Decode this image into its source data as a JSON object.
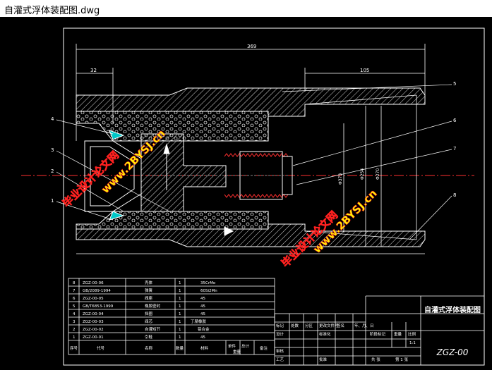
{
  "window": {
    "title": "自灌式浮体装配图.dwg"
  },
  "dims": {
    "overall": "369",
    "left": "32",
    "right": "105",
    "d1": "Φ373",
    "d2": "Φ254",
    "d3": "Φ270"
  },
  "leaders": [
    "5",
    "6",
    "7",
    "8",
    "4",
    "3",
    "2",
    "1"
  ],
  "watermarks": [
    "毕业设计论文网",
    "www.2BYSJ.cn"
  ],
  "bom": {
    "rows": [
      {
        "no": "8",
        "code": "ZGZ-00-06",
        "name": "壳体",
        "qty": "1",
        "mat": "35CrMo"
      },
      {
        "no": "7",
        "code": "GB/2089-1994",
        "name": "弹簧",
        "qty": "1",
        "mat": "60Si2Mn"
      },
      {
        "no": "6",
        "code": "ZGZ-00-05",
        "name": "阀座",
        "qty": "1",
        "mat": "45"
      },
      {
        "no": "5",
        "code": "GB/T6853-1999",
        "name": "橡胶密封",
        "qty": "1",
        "mat": "45"
      },
      {
        "no": "4",
        "code": "ZGZ-00-04",
        "name": "挡圈",
        "qty": "1",
        "mat": "45"
      },
      {
        "no": "3",
        "code": "ZGZ-00-03",
        "name": "阀芯",
        "qty": "1",
        "mat": "丁腈橡胶"
      },
      {
        "no": "2",
        "code": "ZGZ-00-02",
        "name": "自灌短节",
        "qty": "1",
        "mat": "铝合金"
      },
      {
        "no": "1",
        "code": "ZGZ-00-01",
        "name": "引鞋",
        "qty": "1",
        "mat": "45"
      }
    ],
    "header": {
      "no": "序号",
      "code": "代号",
      "name": "名称",
      "qty": "数量",
      "mat": "材料",
      "unit": "单件",
      "total": "总计",
      "weight": "重量",
      "remark": "备注"
    }
  },
  "titleblock": {
    "title": "自灌式浮体装配图",
    "drawing_no": "ZGZ-00",
    "scale": "1:1",
    "labels": {
      "mark": "标记",
      "count": "处数",
      "zone": "分区",
      "change": "更改文件号",
      "sign": "签名",
      "date": "年、月、日",
      "design": "设计",
      "std": "标准化",
      "check": "审核",
      "process": "工艺",
      "approve": "批准",
      "stage": "阶段标记",
      "weight": "重量",
      "ratio": "比例",
      "sheets": "共 张",
      "sheet": "第 1 张"
    }
  }
}
